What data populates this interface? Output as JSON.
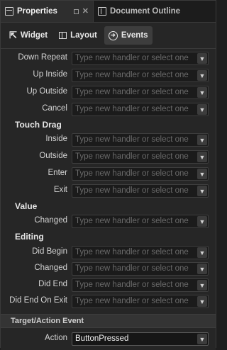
{
  "tabs": {
    "properties": "Properties",
    "outline": "Document Outline"
  },
  "subtabs": {
    "widget": "Widget",
    "layout": "Layout",
    "events": "Events"
  },
  "placeholder": "Type new handler or select one",
  "rows_top": [
    {
      "label": "Down Repeat"
    },
    {
      "label": "Up Inside"
    },
    {
      "label": "Up Outside"
    },
    {
      "label": "Cancel"
    }
  ],
  "sections": {
    "touch_drag": "Touch Drag",
    "value": "Value",
    "editing": "Editing"
  },
  "touch_drag_rows": [
    {
      "label": "Inside"
    },
    {
      "label": "Outside"
    },
    {
      "label": "Enter"
    },
    {
      "label": "Exit"
    }
  ],
  "value_rows": [
    {
      "label": "Changed"
    }
  ],
  "editing_rows": [
    {
      "label": "Did Begin"
    },
    {
      "label": "Changed"
    },
    {
      "label": "Did End"
    },
    {
      "label": "Did End On Exit"
    }
  ],
  "target_action": {
    "header": "Target/Action Event",
    "label": "Action",
    "value": "ButtonPressed"
  },
  "icons": {
    "properties_tab": "properties-panel-icon",
    "outline_tab": "document-outline-icon",
    "widget": "pointer-arrow-icon",
    "layout": "layout-icon",
    "events": "events-icon",
    "dropdown": "dropdown-arrow-icon"
  }
}
